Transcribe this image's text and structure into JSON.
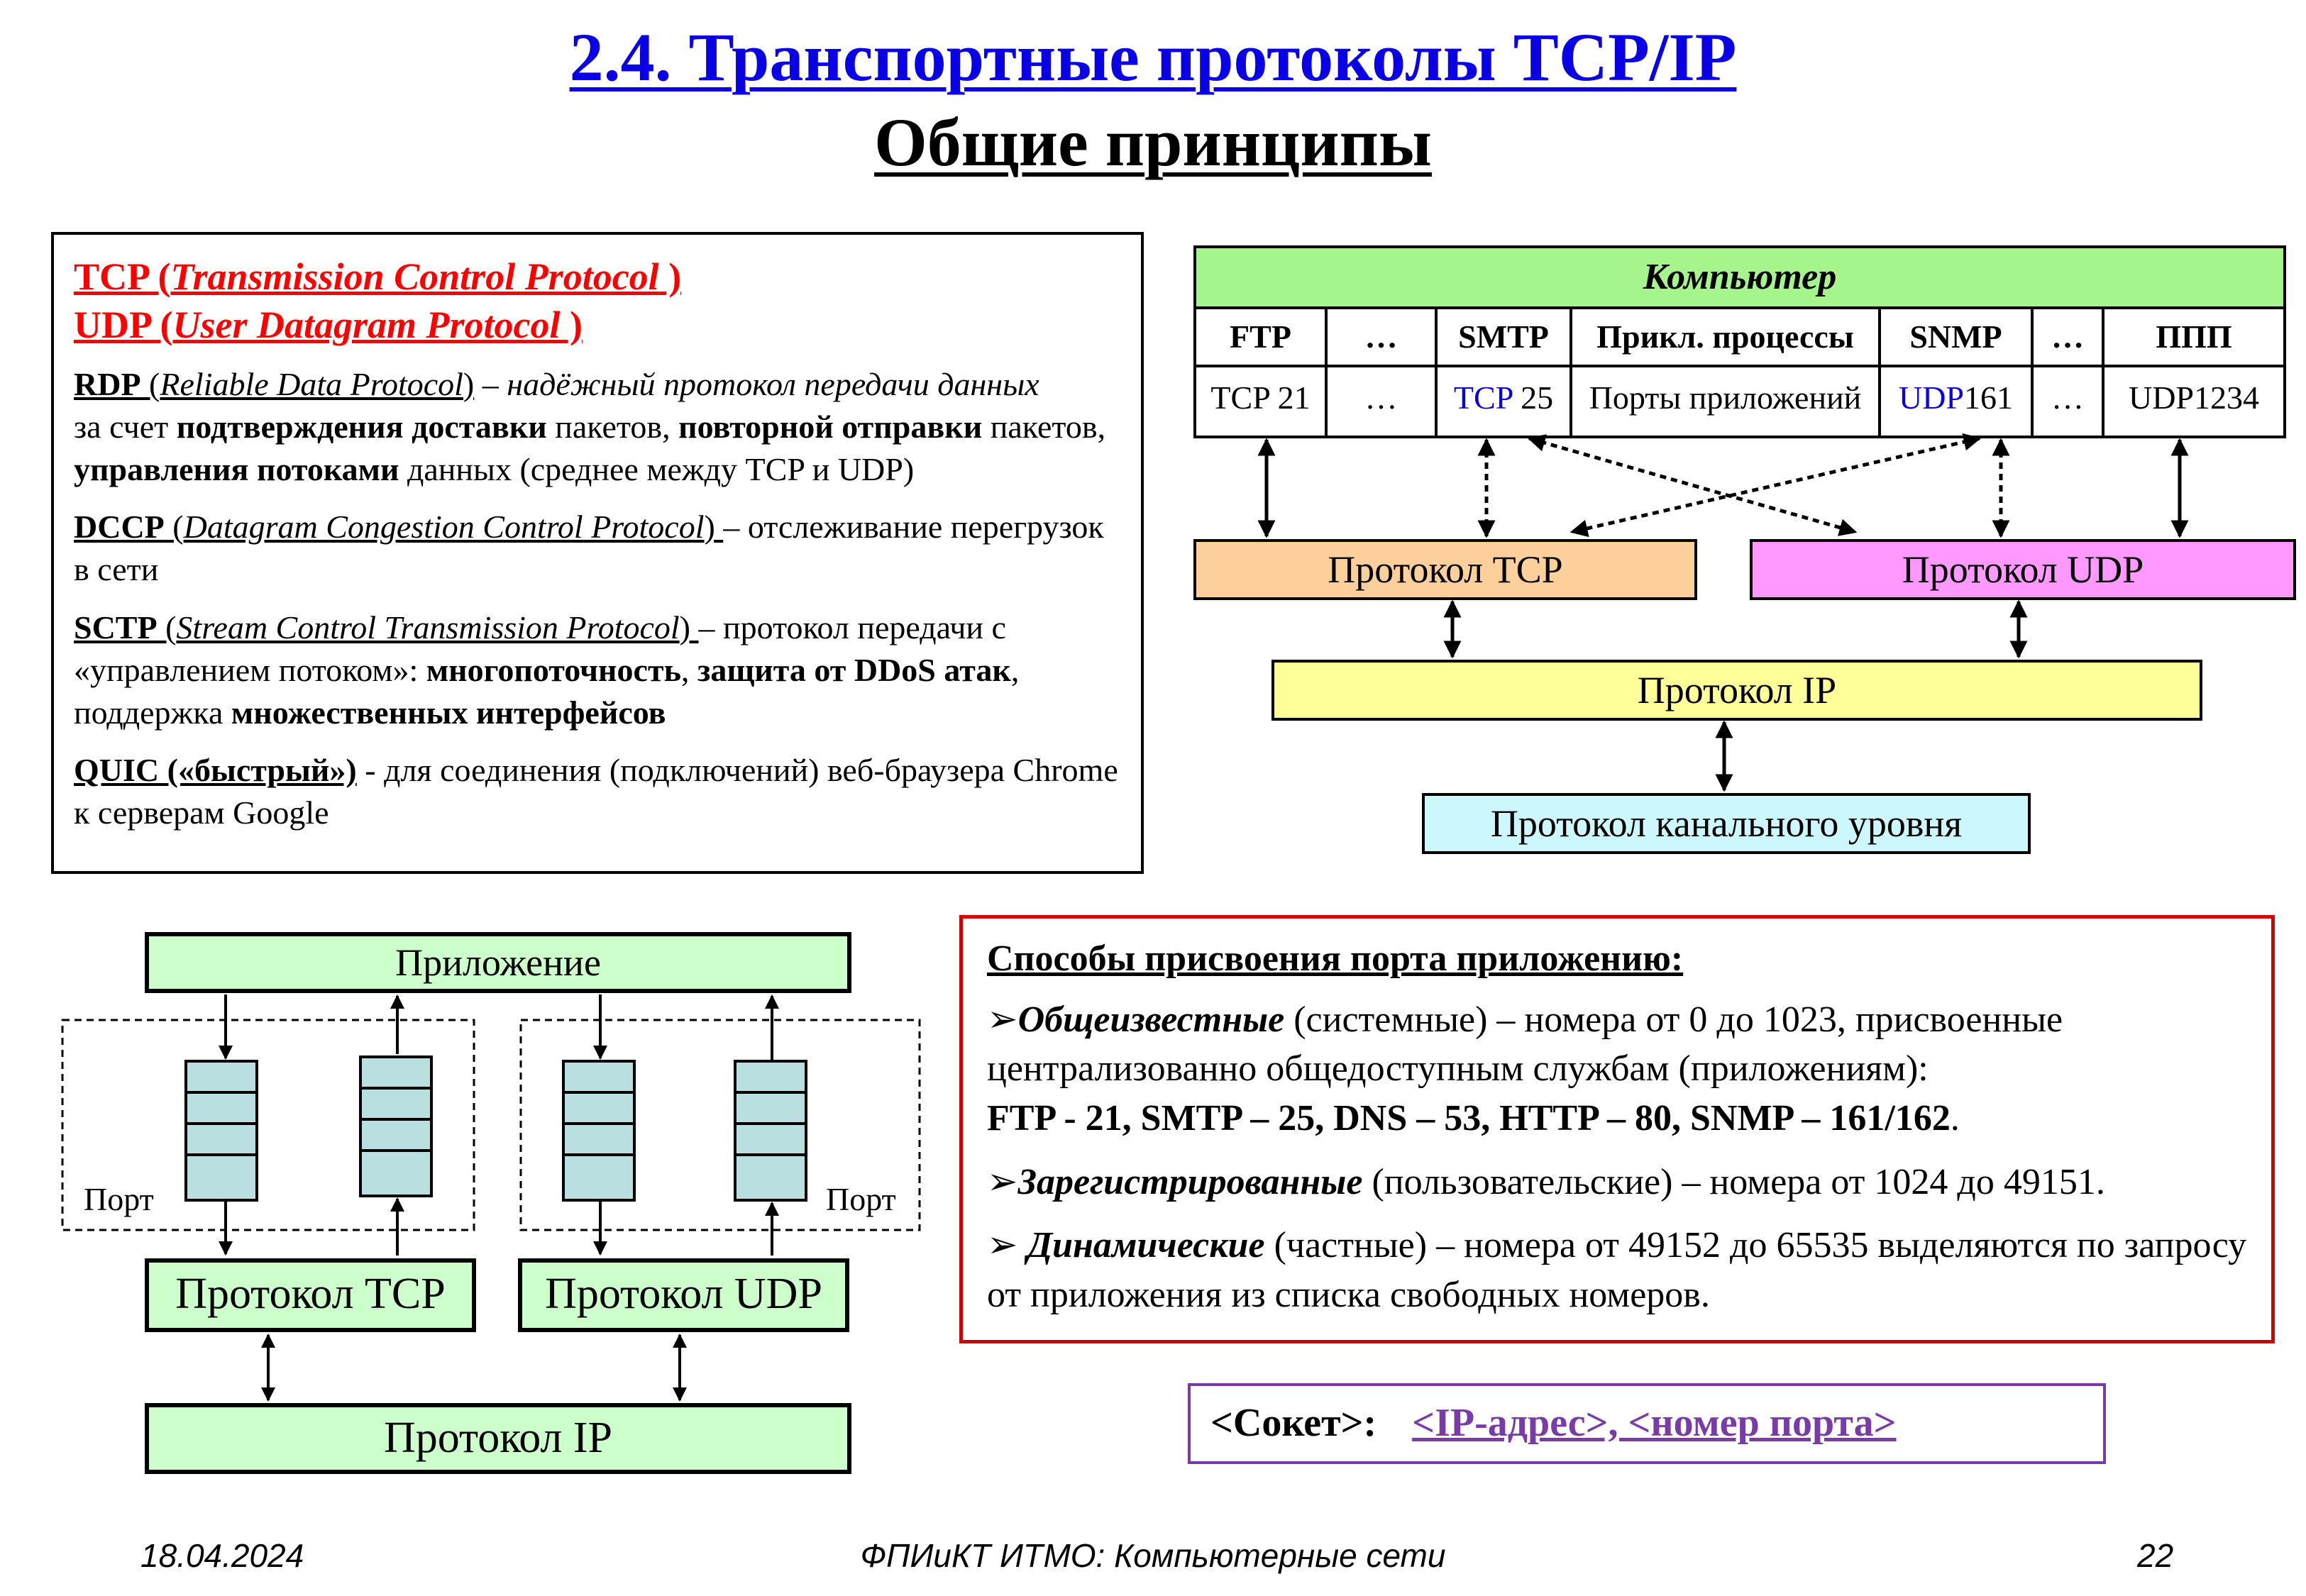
{
  "title": "2.4. Транспортные протоколы TCP/IP",
  "subtitle": "Общие принципы",
  "protocols": {
    "tcp": {
      "abbr": "TCP",
      "full": "Transmission Control Protocol"
    },
    "udp": {
      "abbr": "UDP",
      "full": "User Datagram Protocol"
    },
    "rdp": {
      "abbr": "RDP",
      "full": "Reliable Data Protocol",
      "desc1": " – надёжный протокол передачи данных",
      "desc2": "за счет ",
      "b1": "подтверждения доставки",
      "t1": " пакетов, ",
      "b2": "повторной отправки",
      "t2": " пакетов, ",
      "b3": "управления потоками",
      "t3": " данных (среднее между TCP и UDP)"
    },
    "dccp": {
      "abbr": "DCCP",
      "full": "Datagram Congestion Control Protocol",
      "desc": " – отслеживание перегрузок в сети"
    },
    "sctp": {
      "abbr": "SCTP",
      "full": "Stream Control Transmission Protocol",
      "desc1": " – протокол  передачи с «управлением потоком»: ",
      "b1": "многопоточность",
      "t1": ", ",
      "b2": "защита от DDoS атак",
      "t2": ", поддержка ",
      "b3": "множественных интерфейсов"
    },
    "quic": {
      "abbr": "QUIC («быстрый»)",
      "desc": " - для соединения (подключений) веб-браузера Chrome к серверам Google"
    }
  },
  "computer": {
    "header": "Компьютер",
    "columns": [
      "FTP",
      "…",
      "SMTP",
      "Прикл. процессы",
      "SNMP",
      "…",
      "ППП"
    ],
    "ports": [
      {
        "proto": "TCP",
        "num": " 21"
      },
      {
        "proto": "",
        "num": "…"
      },
      {
        "proto": "TCP",
        "num": " 25"
      },
      {
        "proto": "",
        "num": "Порты приложений"
      },
      {
        "proto": "UDP",
        "num": "161"
      },
      {
        "proto": "",
        "num": "…"
      },
      {
        "proto": "UDP",
        "num": "1234"
      }
    ]
  },
  "stack": {
    "tcp": "Протокол TCP",
    "udp": "Протокол UDP",
    "ip": "Протокол IP",
    "link": "Протокол канального уровня"
  },
  "lower_diagram": {
    "app": "Приложение",
    "port_left": "Порт",
    "port_right": "Порт",
    "tcp": "Протокол TCP",
    "udp": "Протокол UDP",
    "ip": "Протокол IP"
  },
  "port_methods": {
    "heading": "Способы присвоения порта приложению:",
    "items": [
      {
        "bullet": "➢",
        "bold": "Общеизвестные",
        "text": " (системные) – номера  от 0 до 1023, присвоенные централизованно общедоступным службам (приложениям):"
      },
      {
        "bullet": "➢",
        "bold": "Зарегистрированные",
        "text": " (пользовательские) – номера от 1024 до 49151."
      },
      {
        "bullet": "➢ ",
        "bold": "Динамические",
        "text": " (частные) – номера от 49152 до 65535 выделяются по запросу от приложения из списка свободных номеров."
      }
    ],
    "examples": "FTP - 21, SMTP – 25, DNS – 53,  HTTP – 80,  SNMP – 161/162",
    "examples_end": "."
  },
  "socket": {
    "label": "<Сокет>:",
    "value": "<IP-адрес>, <номер порта>"
  },
  "footer": {
    "date": "18.04.2024",
    "course": "ФПИиКТ ИТМО: Компьютерные сети",
    "page": "22"
  },
  "colors": {
    "title": "#0a00e6",
    "computer_header": "#a6f48c",
    "tcp": "#fdd09b",
    "udp": "#ff99ff",
    "ip": "#ffff99",
    "link": "#ccf7fd",
    "green_box": "#ccffcc",
    "queue": "#b9dfe0",
    "red_text": "#ff0000",
    "red_border": "#d30000",
    "socket": "#7a3aa8"
  }
}
